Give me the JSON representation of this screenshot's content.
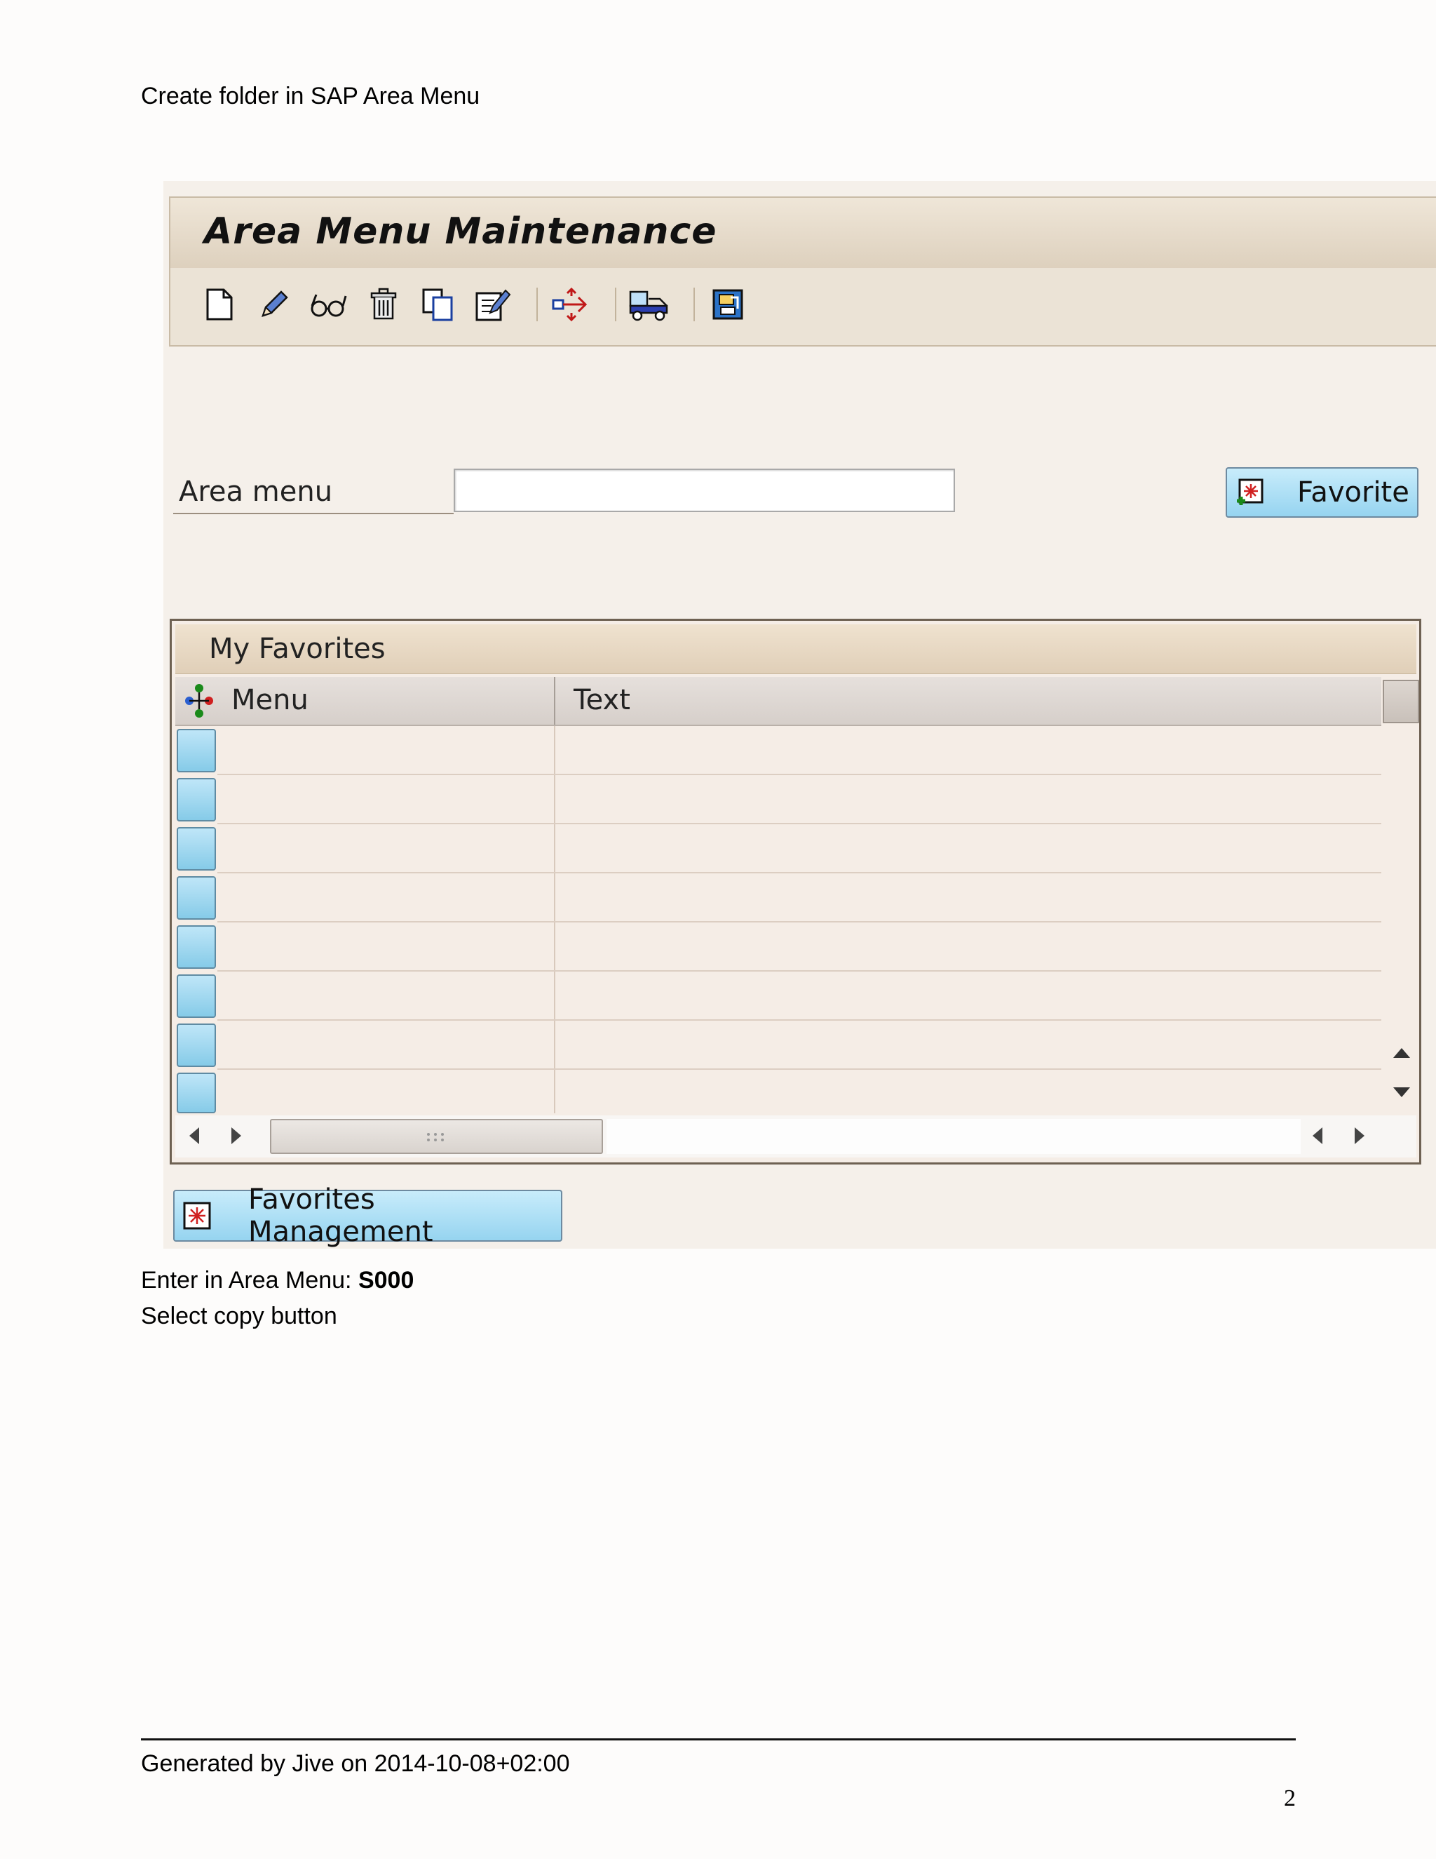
{
  "document": {
    "heading": "Create folder in SAP Area Menu",
    "instruction_1_prefix": "Enter in Area Menu: ",
    "instruction_1_value": "S000",
    "instruction_2": "Select copy button",
    "footer": "Generated by Jive on 2014-10-08+02:00",
    "page_number": "2"
  },
  "sap_screen": {
    "title": "Area Menu Maintenance",
    "toolbar_icons": [
      "create-icon",
      "change-icon",
      "display-icon",
      "delete-icon",
      "copy-icon",
      "rename-icon",
      "transport-icon",
      "truck-icon",
      "info-icon"
    ],
    "area_menu_label": "Area menu",
    "area_menu_value": "",
    "favorite_button": "Favorite",
    "favorites_panel": {
      "title": "My Favorites",
      "columns": [
        "Menu",
        "Text"
      ],
      "rows": [
        "",
        "",
        "",
        "",
        "",
        "",
        "",
        ""
      ]
    },
    "favorites_management_button": "Favorites Management"
  }
}
